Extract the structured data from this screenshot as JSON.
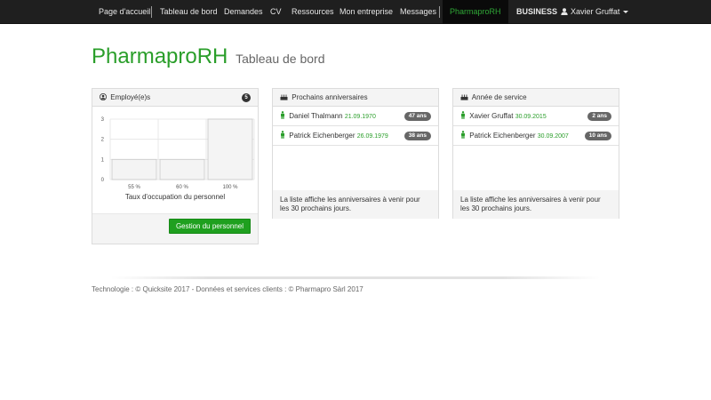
{
  "nav": {
    "items": [
      "Page d'accueil",
      "Tableau de bord",
      "Demandes",
      "CV",
      "Ressources",
      "Mon entreprise",
      "Messages"
    ],
    "active": "PharmaproRH",
    "business": "BUSINESS",
    "user": "Xavier Gruffat"
  },
  "page": {
    "title": "PharmaproRH",
    "subtitle": "Tableau de bord"
  },
  "employees": {
    "header": "Employé(e)s",
    "count": "5",
    "button": "Gestion du personnel"
  },
  "chart_data": {
    "type": "bar",
    "categories": [
      "55 %",
      "60 %",
      "100 %"
    ],
    "values": [
      1,
      1,
      3
    ],
    "ylim": [
      0,
      3
    ],
    "yticks": [
      "0",
      "1",
      "2",
      "3"
    ],
    "xlabel": "Taux d'occupation du personnel",
    "colors": {
      "bar_fill": "#f4f4f4",
      "bar_stroke": "#c8c8c8",
      "grid": "#e4e4e4"
    }
  },
  "birthdays": {
    "header": "Prochains anniversaires",
    "rows": [
      {
        "name": "Daniel Thalmann",
        "date": "21.09.1970",
        "badge": "47 ans"
      },
      {
        "name": "Patrick Eichenberger",
        "date": "26.09.1979",
        "badge": "38 ans"
      }
    ],
    "footer": "La liste affiche les anniversaires à venir pour les 30 prochains jours."
  },
  "service": {
    "header": "Année de service",
    "rows": [
      {
        "name": "Xavier Gruffat",
        "date": "30.09.2015",
        "badge": "2 ans"
      },
      {
        "name": "Patrick Eichenberger",
        "date": "30.09.2007",
        "badge": "10 ans"
      }
    ],
    "footer": "La liste affiche les anniversaires à venir pour les 30 prochains jours."
  },
  "footer": {
    "text": "Technologie : © Quicksite 2017 - Données et services clients : © Pharmapro Sàrl 2017"
  },
  "colors": {
    "accent": "#2a9e2a",
    "navbar": "#1f1f1f",
    "button": "#1fa01f"
  }
}
